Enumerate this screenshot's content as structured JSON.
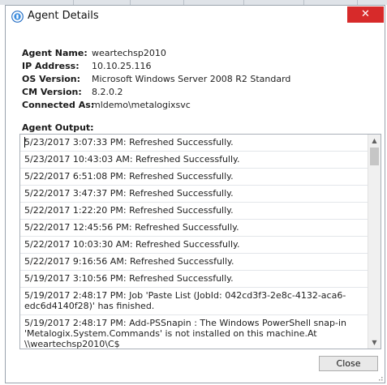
{
  "window": {
    "title": "Agent Details",
    "close_glyph": "✕",
    "close_color": "#d72a2a",
    "icon": "agent-icon"
  },
  "info": [
    {
      "label": "Agent Name:",
      "value": "weartechsp2010"
    },
    {
      "label": "IP Address:",
      "value": "10.10.25.116"
    },
    {
      "label": "OS Version:",
      "value": "Microsoft Windows Server 2008 R2 Standard"
    },
    {
      "label": "CM Version:",
      "value": "8.2.0.2"
    },
    {
      "label": "Connected As:",
      "value": "mldemo\\metalogixsvc"
    }
  ],
  "output": {
    "label": "Agent Output:",
    "lines": [
      "5/23/2017 3:07:33 PM: Refreshed Successfully.",
      "5/23/2017 10:43:03 AM: Refreshed Successfully.",
      "5/22/2017 6:51:08 PM: Refreshed Successfully.",
      "5/22/2017 3:47:37 PM: Refreshed Successfully.",
      "5/22/2017 1:22:20 PM: Refreshed Successfully.",
      "5/22/2017 12:45:56 PM: Refreshed Successfully.",
      "5/22/2017 10:03:30 AM: Refreshed Successfully.",
      "5/22/2017 9:16:56 AM: Refreshed Successfully.",
      "5/19/2017 3:10:56 PM: Refreshed Successfully.",
      "5/19/2017 2:48:17 PM: Job 'Paste List (JobId: 042cd3f3-2e8c-4132-aca6-edc6d4140f28)' has finished.",
      "5/19/2017 2:48:17 PM: Add-PSSnapin : The Windows PowerShell snap-in 'Metalogix.System.Commands' is not installed on this machine.At \\\\weartechsp2010\\C$"
    ],
    "scroll_up": "▲",
    "scroll_down": "▼"
  },
  "buttons": {
    "close": "Close"
  }
}
